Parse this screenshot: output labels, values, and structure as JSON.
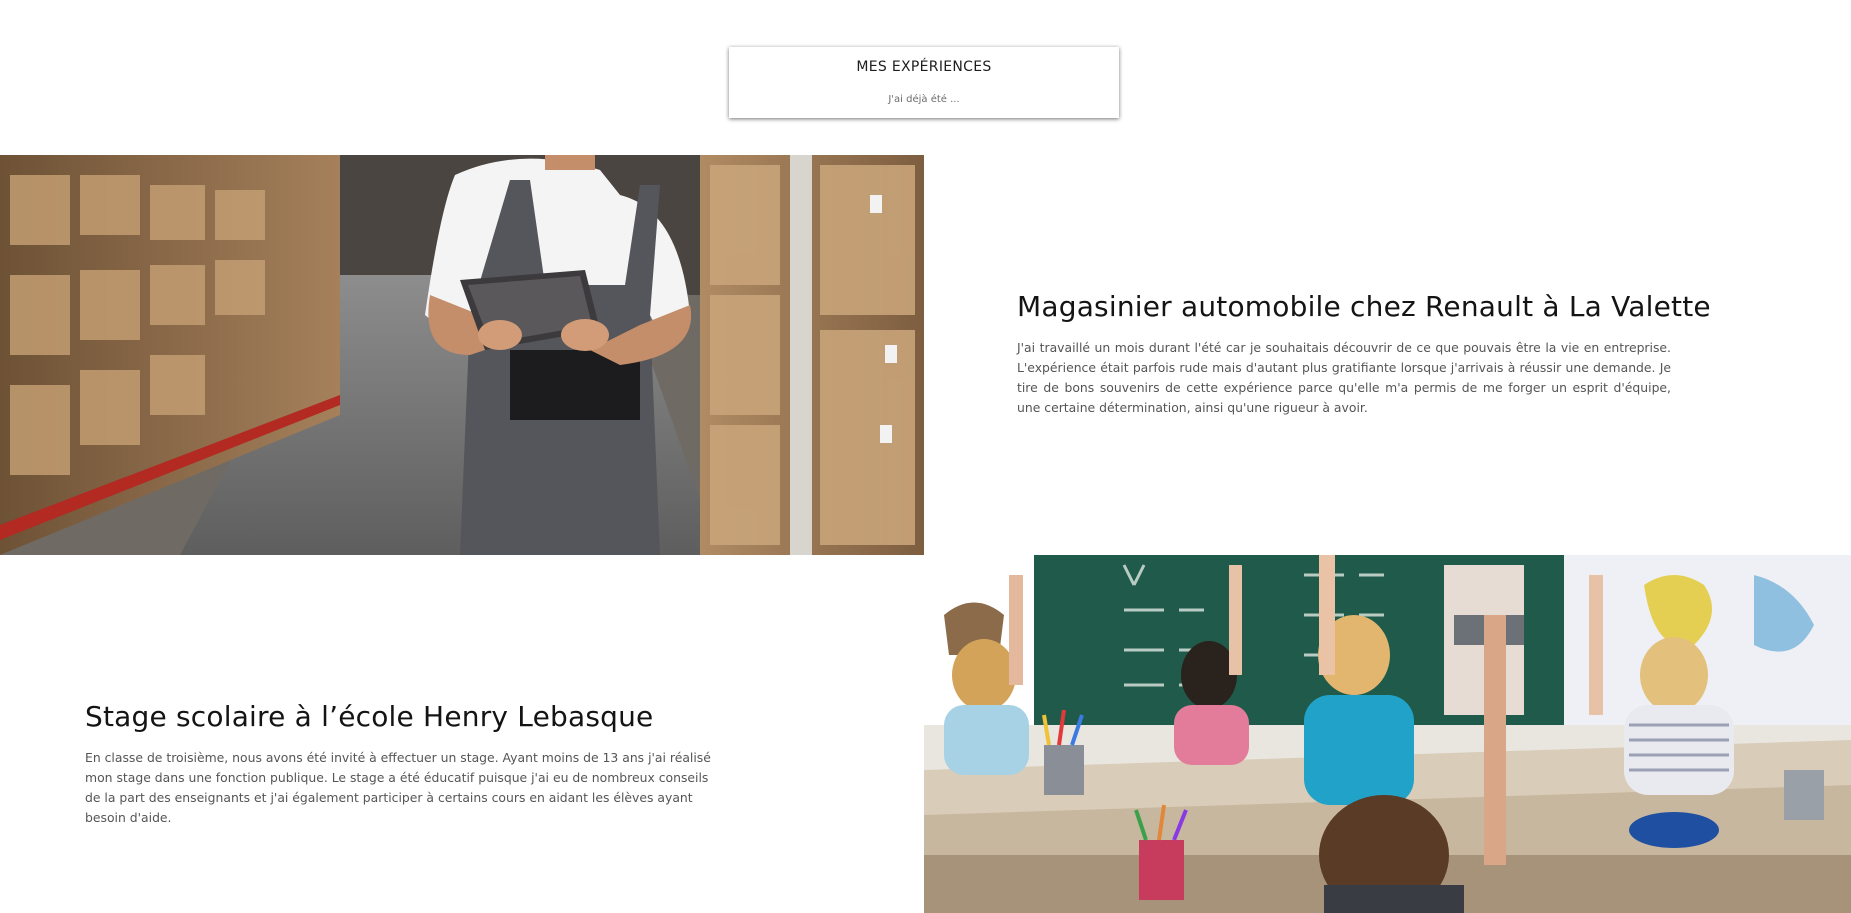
{
  "section": {
    "title": "MES EXPÉRIENCES",
    "subtitle": "J'ai déjà été ..."
  },
  "experiences": [
    {
      "title": "Magasinier automobile chez Renault à La Valette",
      "text": "J'ai travaillé un mois durant l'été car je souhaitais découvrir de ce que pouvais être la vie en entreprise. L'expérience était parfois rude mais d'autant plus gratifiante lorsque j'arrivais à réussir une demande. Je tire de bons souvenirs de cette expérience parce qu'elle m'a permis de me forger un esprit d'équipe, une certaine détermination, ainsi qu'une rigueur à avoir.",
      "image_icon": "warehouse-worker-photo"
    },
    {
      "title": "Stage scolaire à l’école Henry Lebasque",
      "text": "En classe de troisième, nous avons été invité à effectuer un stage. Ayant moins de 13 ans j'ai réalisé mon stage dans une fonction publique. Le stage a été éducatif puisque j'ai eu de nombreux conseils de la part des enseignants et j'ai également participer à certains cours en aidant les élèves ayant besoin d'aide.",
      "image_icon": "classroom-photo"
    }
  ],
  "colors": {
    "background": "#ffffff",
    "title_text": "#141414",
    "body_text": "#555555",
    "chalkboard": "#1f5a4a",
    "cardboard": "#a9825a"
  }
}
